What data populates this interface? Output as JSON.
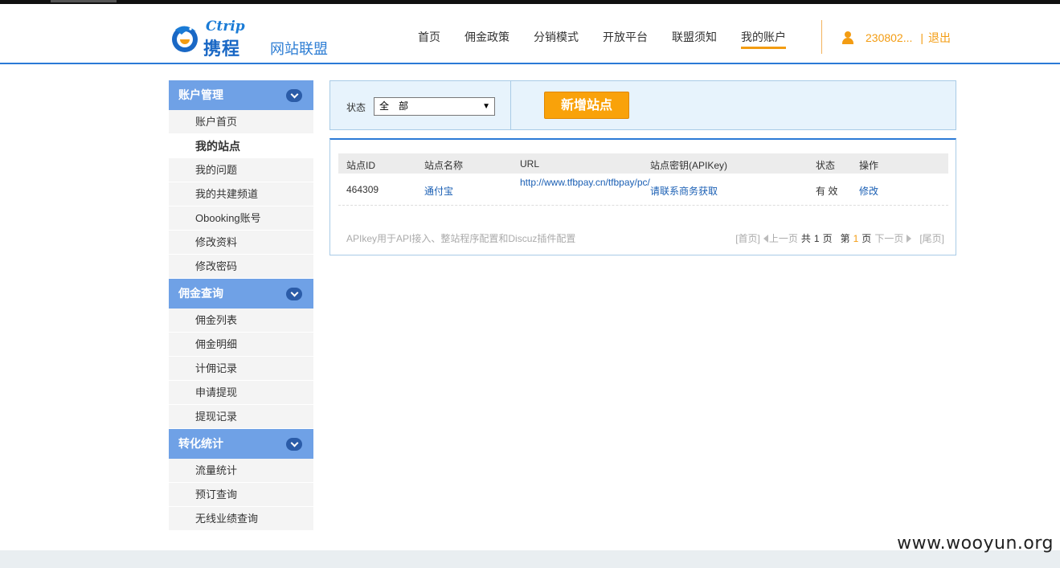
{
  "header": {
    "logo_latin": "Ctrip",
    "logo_cn": "携程",
    "logo_sub": "网站联盟",
    "nav": [
      {
        "label": "首页"
      },
      {
        "label": "佣金政策"
      },
      {
        "label": "分销模式"
      },
      {
        "label": "开放平台"
      },
      {
        "label": "联盟须知"
      },
      {
        "label": "我的账户",
        "active": true
      }
    ],
    "user_id": "230802...",
    "logout": "退出"
  },
  "sidebar": {
    "groups": [
      {
        "title": "账户管理",
        "items": [
          "账户首页",
          "我的站点",
          "我的问题",
          "我的共建频道",
          "Obooking账号",
          "修改资料",
          "修改密码"
        ]
      },
      {
        "title": "佣金查询",
        "items": [
          "佣金列表",
          "佣金明细",
          "计佣记录",
          "申请提现",
          "提现记录"
        ]
      },
      {
        "title": "转化统计",
        "items": [
          "流量统计",
          "预订查询",
          "无线业绩查询"
        ]
      }
    ],
    "active_item": "我的站点"
  },
  "filter": {
    "label": "状态",
    "selected": "全　部",
    "add_button": "新增站点"
  },
  "table": {
    "columns": [
      "站点ID",
      "站点名称",
      "URL",
      "站点密钥(APIKey)",
      "状态",
      "操作"
    ],
    "rows": [
      {
        "id": "464309",
        "name": "通付宝",
        "url": "http://www.tfbpay.cn/tfbpay/pc/",
        "apikey": "请联系商务获取",
        "status": "有 效",
        "action": "修改"
      }
    ],
    "note": "APIkey用于API接入、整站程序配置和Discuz插件配置",
    "pager": {
      "first": "[首页]",
      "prev": "上一页",
      "total_prefix": "共",
      "total": "1",
      "total_suffix": "页",
      "current_prefix": "第",
      "current": "1",
      "current_suffix": "页",
      "next": "下一页",
      "last": "[尾页]"
    }
  },
  "watermark": "www.wooyun.org",
  "colors": {
    "brand_blue": "#2b7ad6",
    "accent_orange": "#f39c12",
    "sidebar_head": "#6fa1e6"
  }
}
